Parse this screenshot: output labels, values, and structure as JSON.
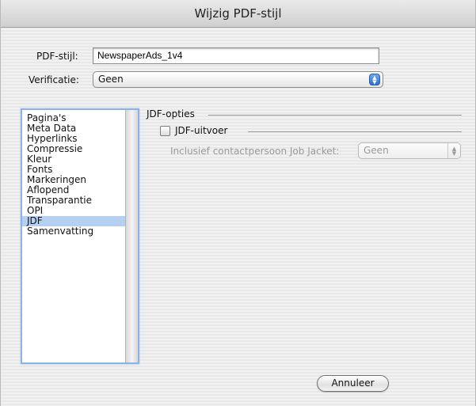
{
  "window": {
    "title": "Wijzig PDF-stijl"
  },
  "pdf_style": {
    "label": "PDF-stijl:",
    "value": "NewspaperAds_1v4"
  },
  "verification": {
    "label": "Verificatie:",
    "selected": "Geen"
  },
  "sidebar": {
    "items": [
      {
        "label": "Pagina's"
      },
      {
        "label": "Meta Data"
      },
      {
        "label": "Hyperlinks"
      },
      {
        "label": "Compressie"
      },
      {
        "label": "Kleur"
      },
      {
        "label": "Fonts"
      },
      {
        "label": "Markeringen"
      },
      {
        "label": "Aflopend"
      },
      {
        "label": "Transparantie"
      },
      {
        "label": "OPI"
      },
      {
        "label": "JDF"
      },
      {
        "label": "Samenvatting"
      }
    ],
    "selected_index": 10
  },
  "jdf": {
    "group_title": "JDF-opties",
    "output_checkbox_label": "JDF-uitvoer",
    "output_checked": false,
    "contact_label": "Inclusief contactpersoon Job Jacket:",
    "contact_selected": "Geen"
  },
  "buttons": {
    "cancel": "Annuleer"
  },
  "colors": {
    "selection": "#b5d0f1",
    "focus_ring": "#8bb3e6",
    "popup_accent": "#2b6fd3"
  }
}
